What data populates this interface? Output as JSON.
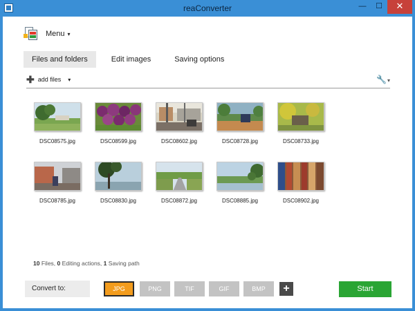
{
  "window": {
    "title": "reaConverter"
  },
  "titlebar": {
    "minimize": "—",
    "maximize": "☐",
    "close": "✕"
  },
  "menu": {
    "label": "Menu",
    "caret": "▾",
    "logo_icon": "reaconverter-logo-icon"
  },
  "tabs": [
    {
      "label": "Files and folders",
      "active": true
    },
    {
      "label": "Edit images",
      "active": false
    },
    {
      "label": "Saving options",
      "active": false
    }
  ],
  "toolbar": {
    "add_files_label": "add files",
    "add_icon": "plus-icon",
    "caret": "▾",
    "tools_icon": "wrench-icon",
    "tools_glyph": "🔧"
  },
  "files": [
    {
      "name": "DSC08575.jpg"
    },
    {
      "name": "DSC08599.jpg"
    },
    {
      "name": "DSC08602.jpg"
    },
    {
      "name": "DSC08728.jpg"
    },
    {
      "name": "DSC08733.jpg"
    },
    {
      "name": "DSC08785.jpg"
    },
    {
      "name": "DSC08830.jpg"
    },
    {
      "name": "DSC08872.jpg"
    },
    {
      "name": "DSC08885.jpg"
    },
    {
      "name": "DSC08902.jpg"
    }
  ],
  "summary": {
    "files_count": "10",
    "files_label": "Files,",
    "actions_count": "0",
    "actions_label": "Editing actions,",
    "paths_count": "1",
    "paths_label": "Saving path"
  },
  "convert": {
    "label": "Convert to:",
    "formats": [
      "JPG",
      "PNG",
      "TIF",
      "GIF",
      "BMP"
    ],
    "selected": "JPG",
    "add_label": "+",
    "start_label": "Start"
  },
  "colors": {
    "accent": "#3a8fd6",
    "selected_format": "#f39c1d",
    "start_button": "#2aa534",
    "close_button": "#c7413a"
  }
}
